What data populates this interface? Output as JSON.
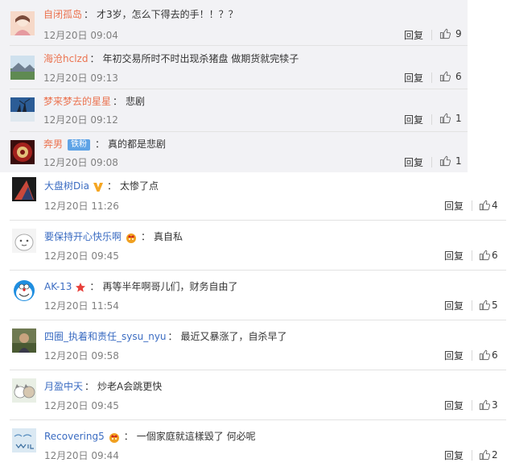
{
  "reply_label": "回复",
  "top_comments": [
    {
      "user": "自闭孤岛",
      "text": "才3岁，怎么下得去的手！！？？",
      "time": "12月20日 09:04",
      "likes": "9"
    },
    {
      "user": "海沧hclzd",
      "text": "年初交易所时不时出现杀猪盘 做期货就完犊子",
      "time": "12月20日 09:13",
      "likes": "6"
    },
    {
      "user": "梦来梦去的星星",
      "text": "悲剧",
      "time": "12月20日 09:12",
      "likes": "1"
    },
    {
      "user": "奔男",
      "tag": "铁粉",
      "text": "真的都是悲剧",
      "time": "12月20日 09:08",
      "likes": "1"
    }
  ],
  "bottom_comments": [
    {
      "user": "大盘树Dia",
      "text": "太惨了点",
      "time": "12月20日 11:26",
      "likes": "4"
    },
    {
      "user": "要保持开心快乐啊",
      "text": "真自私",
      "time": "12月20日 09:45",
      "likes": "6"
    },
    {
      "user": "AK-13",
      "text": "再等半年啊哥儿们，财务自由了",
      "time": "12月20日 11:54",
      "likes": "5"
    },
    {
      "user": "四圈_执着和责任_sysu_nyu",
      "text": "最近又暴涨了，自杀早了",
      "time": "12月20日 09:58",
      "likes": "6"
    },
    {
      "user": "月盈中天",
      "text": "炒老A会跳更快",
      "time": "12月20日 09:45",
      "likes": "3"
    },
    {
      "user": "Recovering5",
      "text": "一個家庭就這樣毀了 何必呢",
      "time": "12月20日 09:44",
      "likes": "2"
    }
  ],
  "colors": {
    "top_username": "#eb7350",
    "bottom_username": "#3b6cc2",
    "top_panel_bg": "#f2f2f5",
    "tag_bg": "#5ea3e6",
    "separator": "#e2e2e2"
  },
  "icons": {
    "like": "thumbs-up-icon",
    "verified": "v-icon",
    "crown": "crown-badge-icon",
    "star": "star-icon"
  }
}
